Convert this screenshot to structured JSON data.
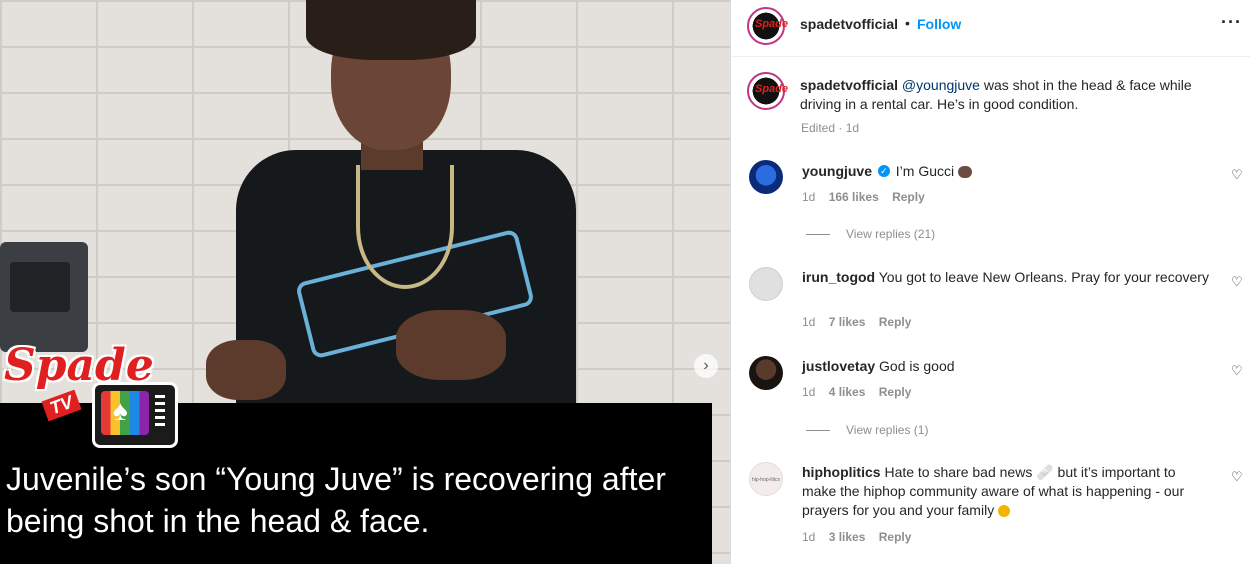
{
  "post": {
    "next_icon": "chevron-right",
    "overlay": {
      "logo_brand": "Spade",
      "logo_sub": "TV",
      "caption": "Juvenile’s son “Young Juve” is recovering after being shot in the head & face."
    }
  },
  "header": {
    "username": "spadetvofficial",
    "separator": "•",
    "follow_label": "Follow",
    "more_label": "···"
  },
  "caption": {
    "username": "spadetvofficial",
    "mention": "@youngjuve",
    "text": " was shot in the head & face while driving in a rental car. He’s in good condition.",
    "meta": "Edited · 1d"
  },
  "comments": [
    {
      "username": "youngjuve",
      "verified": true,
      "text": "I’m Gucci",
      "emoji": "flexed-biceps",
      "time": "1d",
      "likes": "166 likes",
      "reply": "Reply",
      "view_replies": "View replies (21)"
    },
    {
      "username": "irun_togod",
      "verified": false,
      "text": "You got to leave New Orleans. Pray for your recovery",
      "time": "1d",
      "likes": "7 likes",
      "reply": "Reply"
    },
    {
      "username": "justlovetay",
      "verified": false,
      "text": "God is good",
      "time": "1d",
      "likes": "4 likes",
      "reply": "Reply",
      "view_replies": "View replies (1)"
    },
    {
      "username": "hiphoplitics",
      "verified": false,
      "text": "Hate to share bad news 🩹 but it’s important to make the hiphop community aware of what is happening - our prayers for you and your family",
      "emoji": "sad-face",
      "avatar_text": "hip-hop-litics",
      "time": "1d",
      "likes": "3 likes",
      "reply": "Reply"
    }
  ],
  "colors": {
    "accent": "#0095f6",
    "text": "#262626",
    "muted": "#8e8e8e",
    "brand_red": "#e02020"
  }
}
